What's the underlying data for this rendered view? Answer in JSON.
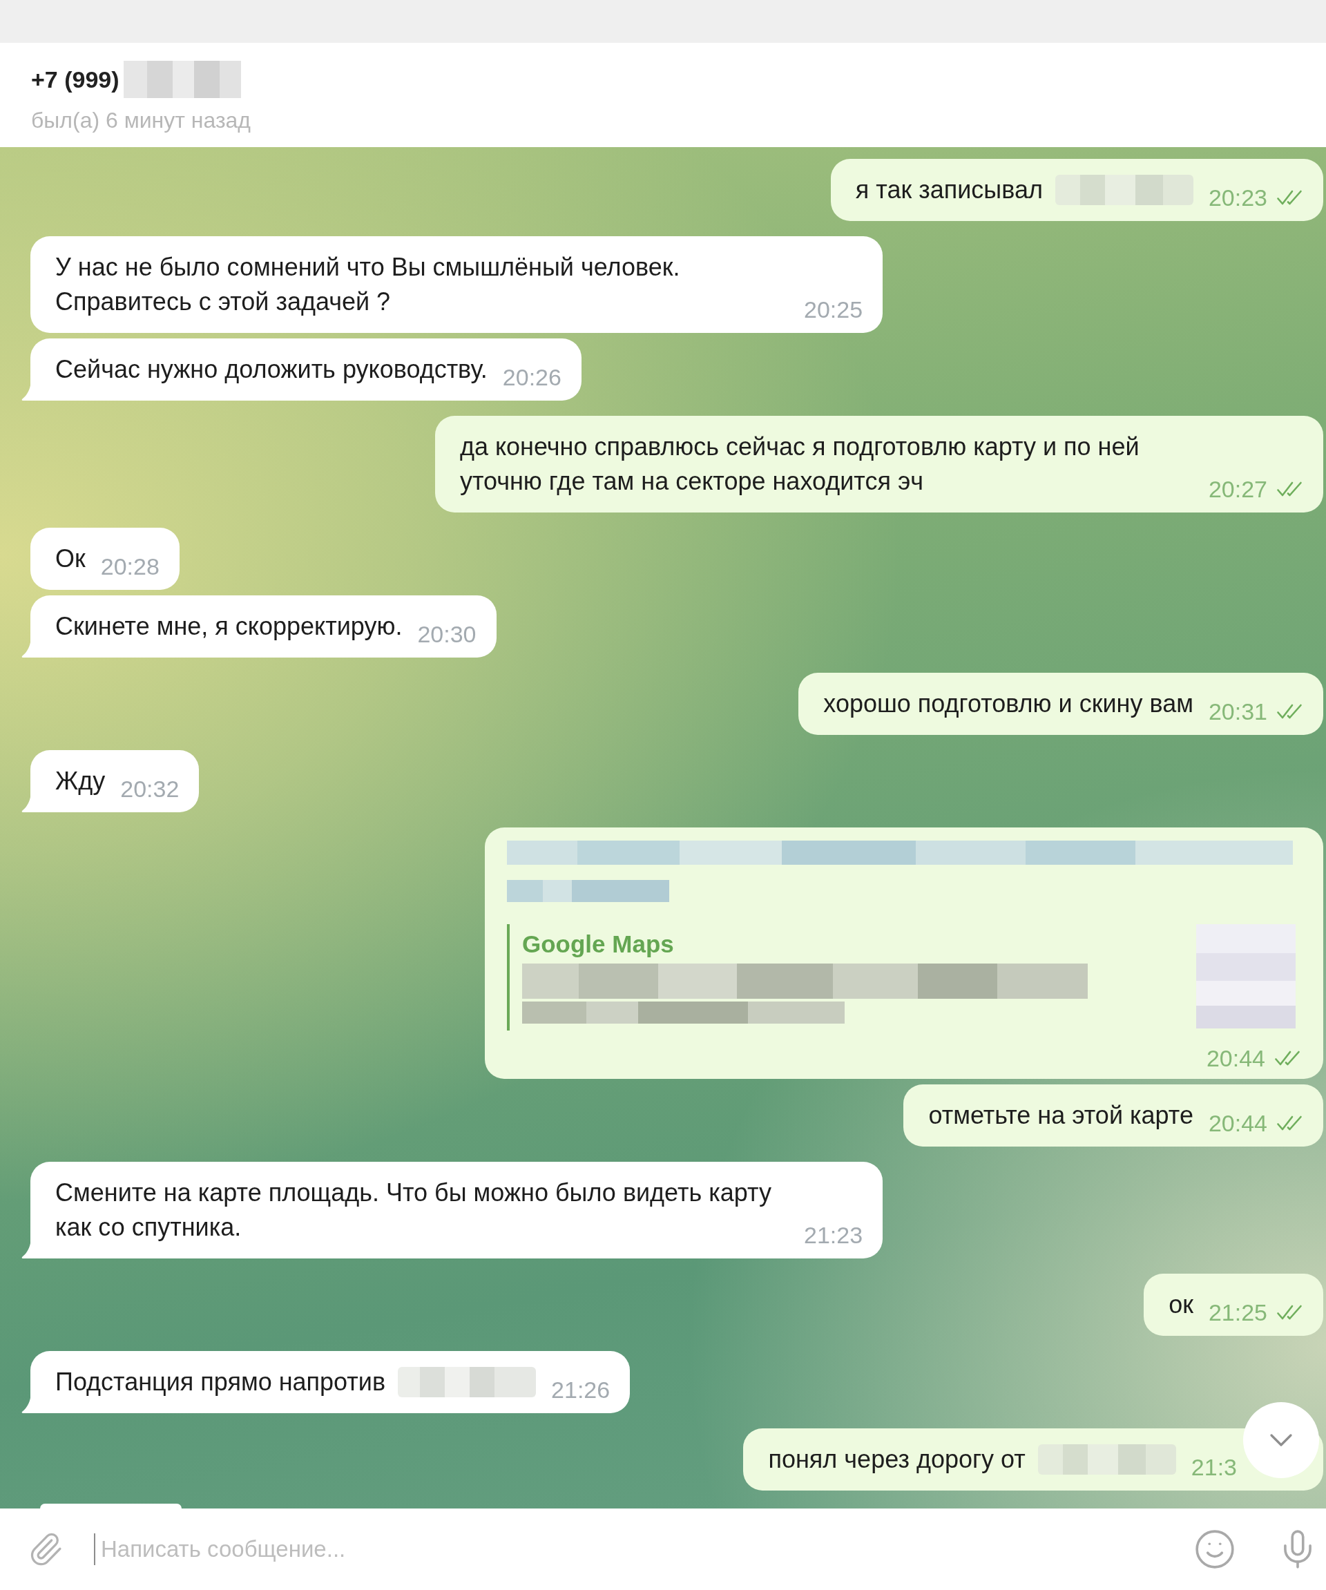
{
  "header": {
    "title": "+7 (999)",
    "title_redacted": true,
    "status": "был(а) 6 минут назад"
  },
  "messages": [
    {
      "outgoing": true,
      "kind": "text",
      "text": "я так записывал",
      "redacted": true,
      "time": "20:23",
      "double_check": true
    },
    {
      "outgoing": false,
      "kind": "text",
      "text": "У нас не было сомнений что Вы смышлёный человек. Справитесь с этой задачей ?",
      "redacted": false,
      "time": "20:25",
      "double_check": false
    },
    {
      "outgoing": false,
      "kind": "text",
      "text": "Сейчас нужно доложить руководству.",
      "redacted": false,
      "time": "20:26",
      "double_check": false
    },
    {
      "outgoing": true,
      "kind": "text",
      "text": "да конечно справлюсь сейчас я подготовлю карту и по ней уточню где там на секторе находится эч",
      "redacted": false,
      "time": "20:27",
      "double_check": true
    },
    {
      "outgoing": false,
      "kind": "text",
      "text": "Ок",
      "redacted": false,
      "time": "20:28",
      "double_check": false
    },
    {
      "outgoing": false,
      "kind": "text",
      "text": "Скинете мне, я скорректирую.",
      "redacted": false,
      "time": "20:30",
      "double_check": false
    },
    {
      "outgoing": true,
      "kind": "text",
      "text": "хорошо подготовлю и скину вам",
      "redacted": false,
      "time": "20:31",
      "double_check": true
    },
    {
      "outgoing": false,
      "kind": "text",
      "text": "Жду",
      "redacted": false,
      "time": "20:32",
      "double_check": false
    },
    {
      "outgoing": true,
      "kind": "link",
      "site": "Google Maps",
      "time": "20:44",
      "double_check": true
    },
    {
      "outgoing": true,
      "kind": "text",
      "text": "отметьте на этой карте",
      "redacted": false,
      "time": "20:44",
      "double_check": true
    },
    {
      "outgoing": false,
      "kind": "text",
      "text": "Смените на карте площадь. Что бы можно было видеть карту как со спутника.",
      "redacted": false,
      "time": "21:23",
      "double_check": false
    },
    {
      "outgoing": true,
      "kind": "text",
      "text": "ок",
      "redacted": false,
      "time": "21:25",
      "double_check": true
    },
    {
      "outgoing": false,
      "kind": "text",
      "text": "Подстанция прямо напротив",
      "redacted": true,
      "time": "21:26",
      "double_check": false
    },
    {
      "outgoing": true,
      "kind": "text",
      "text": "понял через дорогу от",
      "redacted": true,
      "time": "21:3",
      "double_check": false
    },
    {
      "outgoing": false,
      "kind": "clipped"
    }
  ],
  "composer": {
    "placeholder": "Написать сообщение..."
  }
}
